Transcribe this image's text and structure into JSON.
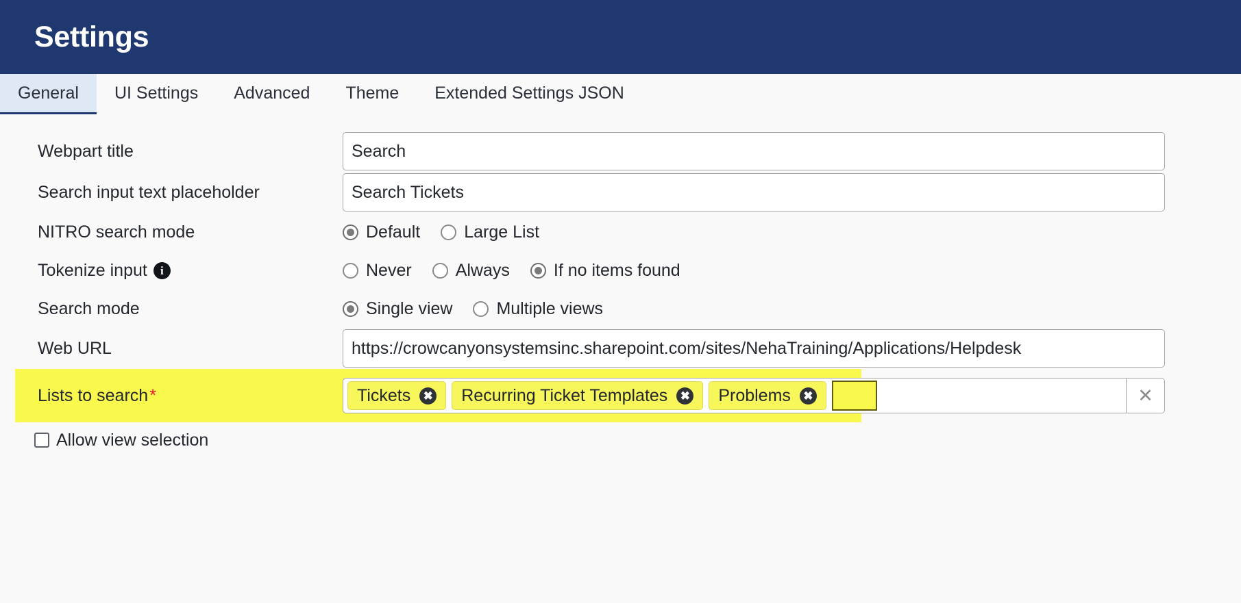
{
  "header": {
    "title": "Settings",
    "bg_color": "#1f3870"
  },
  "tabs": [
    {
      "label": "General",
      "active": true
    },
    {
      "label": "UI Settings",
      "active": false
    },
    {
      "label": "Advanced",
      "active": false
    },
    {
      "label": "Theme",
      "active": false
    },
    {
      "label": "Extended Settings JSON",
      "active": false
    }
  ],
  "form": {
    "webpart_title": {
      "label": "Webpart title",
      "value": "Search"
    },
    "search_placeholder": {
      "label": "Search input text placeholder",
      "value": "Search Tickets"
    },
    "nitro_search_mode": {
      "label": "NITRO search mode",
      "options": [
        "Default",
        "Large List"
      ],
      "selected": "Default"
    },
    "tokenize_input": {
      "label": "Tokenize input",
      "info_icon": "info-icon",
      "options": [
        "Never",
        "Always",
        "If no items found"
      ],
      "selected": "If no items found"
    },
    "search_mode": {
      "label": "Search mode",
      "options": [
        "Single view",
        "Multiple views"
      ],
      "selected": "Single view"
    },
    "web_url": {
      "label": "Web URL",
      "value": "https://crowcanyonsystemsinc.sharepoint.com/sites/NehaTraining/Applications/Helpdesk"
    },
    "lists_to_search": {
      "label": "Lists to search",
      "required_marker": "*",
      "highlighted": true,
      "highlight_color": "#f9f84d",
      "tags": [
        "Tickets",
        "Recurring Ticket Templates",
        "Problems"
      ],
      "tag_remove_icon": "✖",
      "input_value": "",
      "clear_icon": "✕"
    },
    "allow_view_selection": {
      "label": "Allow view selection",
      "checked": false
    }
  }
}
